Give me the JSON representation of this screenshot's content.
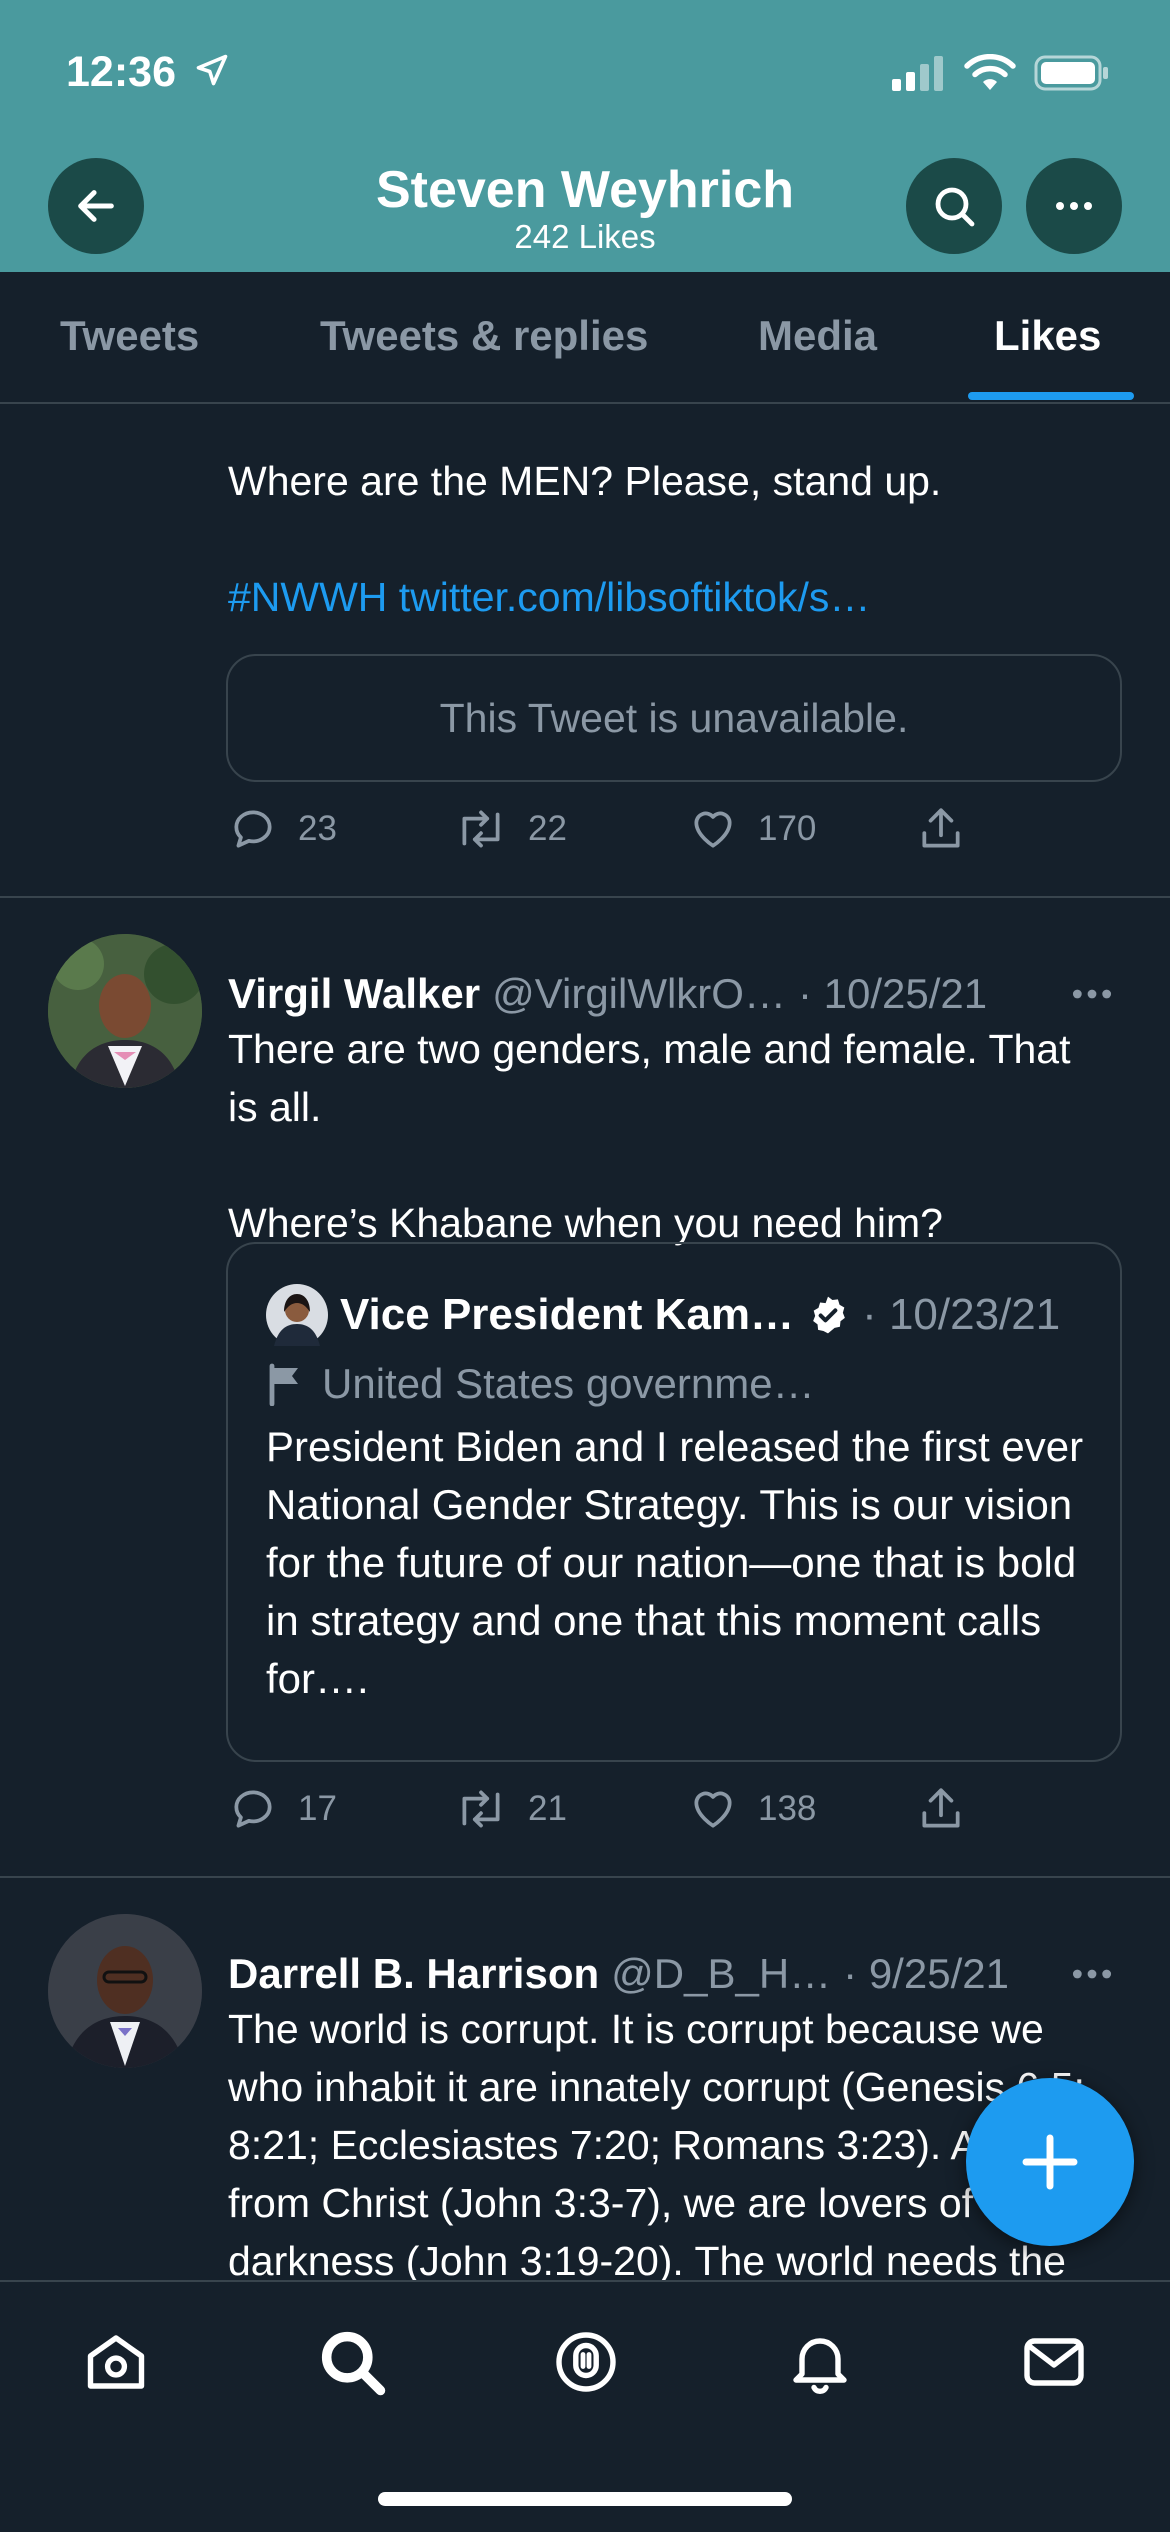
{
  "status": {
    "time": "12:36"
  },
  "header": {
    "title": "Steven Weyhrich",
    "subtitle": "242 Likes"
  },
  "tabs": [
    {
      "label": "Tweets"
    },
    {
      "label": "Tweets & replies"
    },
    {
      "label": "Media"
    },
    {
      "label": "Likes"
    }
  ],
  "tweets": [
    {
      "text": "Where are the MEN? Please, stand up.",
      "links": "#NWWH twitter.com/libsoftiktok/s…",
      "unavailable": "This Tweet is unavailable.",
      "replies": "23",
      "retweets": "22",
      "likes": "170"
    },
    {
      "name": "Virgil Walker",
      "handle": "@VirgilWlkrO…",
      "date": "· 10/25/21",
      "text": "There are two genders, male and female. That is all.\n\nWhere’s Khabane when you need him?",
      "quote": {
        "name": "Vice President Kam…",
        "date": "· 10/23/21",
        "label": "United States governme…",
        "text": "President Biden and I released the first ever National Gender Strategy. This is our vision for the future of our nation—one that is bold in strategy and one that this moment calls for…."
      },
      "replies": "17",
      "retweets": "21",
      "likes": "138"
    },
    {
      "name": "Darrell B. Harrison",
      "handle": "@D_B_H…",
      "date": "· 9/25/21",
      "text": "The world is corrupt. It is corrupt because we who inhabit it are innately corrupt (Genesis 6:5; 8:21; Ecclesiastes 7:20; Romans 3:23). Apart from Christ (John 3:3-7), we are lovers of darkness (John 3:19-20). The world needs the Gospel."
    }
  ],
  "colors": {
    "header": "#4a9a9e",
    "background": "#15202b",
    "accent": "#1d9bf0",
    "muted": "#8b98a5"
  },
  "icons": [
    "location-arrow-icon",
    "signal-icon",
    "wifi-icon",
    "battery-icon",
    "back-icon",
    "search-icon",
    "more-icon",
    "reply-icon",
    "retweet-icon",
    "like-icon",
    "share-icon",
    "verified-icon",
    "flag-icon",
    "compose-icon",
    "home-icon",
    "explore-icon",
    "spaces-icon",
    "notifications-icon",
    "messages-icon"
  ]
}
